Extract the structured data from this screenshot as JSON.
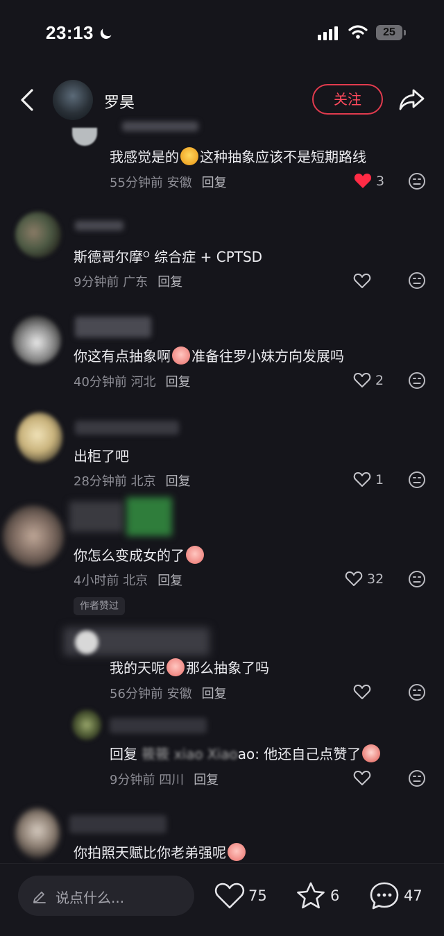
{
  "status_bar": {
    "time": "23:13",
    "battery": "25"
  },
  "header": {
    "username": "罗昊",
    "follow_label": "关注"
  },
  "comments": [
    {
      "text_before": "我感觉是的",
      "text_after": "这种抽象应该不是短期路线",
      "time": "55分钟前",
      "location": "安徽",
      "reply": "回复",
      "likes": "3",
      "liked": true
    },
    {
      "text": "斯德哥尔摩ᴼ 综合症  + CPTSD",
      "time": "9分钟前",
      "location": "广东",
      "reply": "回复",
      "likes": ""
    },
    {
      "text_before": "你这有点抽象啊",
      "text_after": "准备往罗小妹方向发展吗",
      "time": "40分钟前",
      "location": "河北",
      "reply": "回复",
      "likes": "2"
    },
    {
      "text": "出柜了吧",
      "time": "28分钟前",
      "location": "北京",
      "reply": "回复",
      "likes": "1"
    },
    {
      "text": "你怎么变成女的了",
      "time": "4小时前",
      "location": "北京",
      "reply": "回复",
      "likes": "32",
      "badge": "作者赞过"
    },
    {
      "text_before": "我的天呢",
      "text_after": "那么抽象了吗",
      "time": "56分钟前",
      "location": "安徽",
      "reply": "回复",
      "likes": ""
    },
    {
      "text": "回复 ",
      "blurred_name": "筱筱 xiao Xiao",
      "text_after": "ao: 他还自己点赞了",
      "time": "9分钟前",
      "location": "四川",
      "reply": "回复",
      "likes": ""
    },
    {
      "text": "你拍照天赋比你老弟强呢"
    }
  ],
  "bottom_bar": {
    "input_placeholder": "说点什么...",
    "likes": "75",
    "stars": "6",
    "comments": "47"
  },
  "colors": {
    "accent": "#e23b4e",
    "liked_heart": "#ff2b45",
    "background": "#15151b"
  }
}
